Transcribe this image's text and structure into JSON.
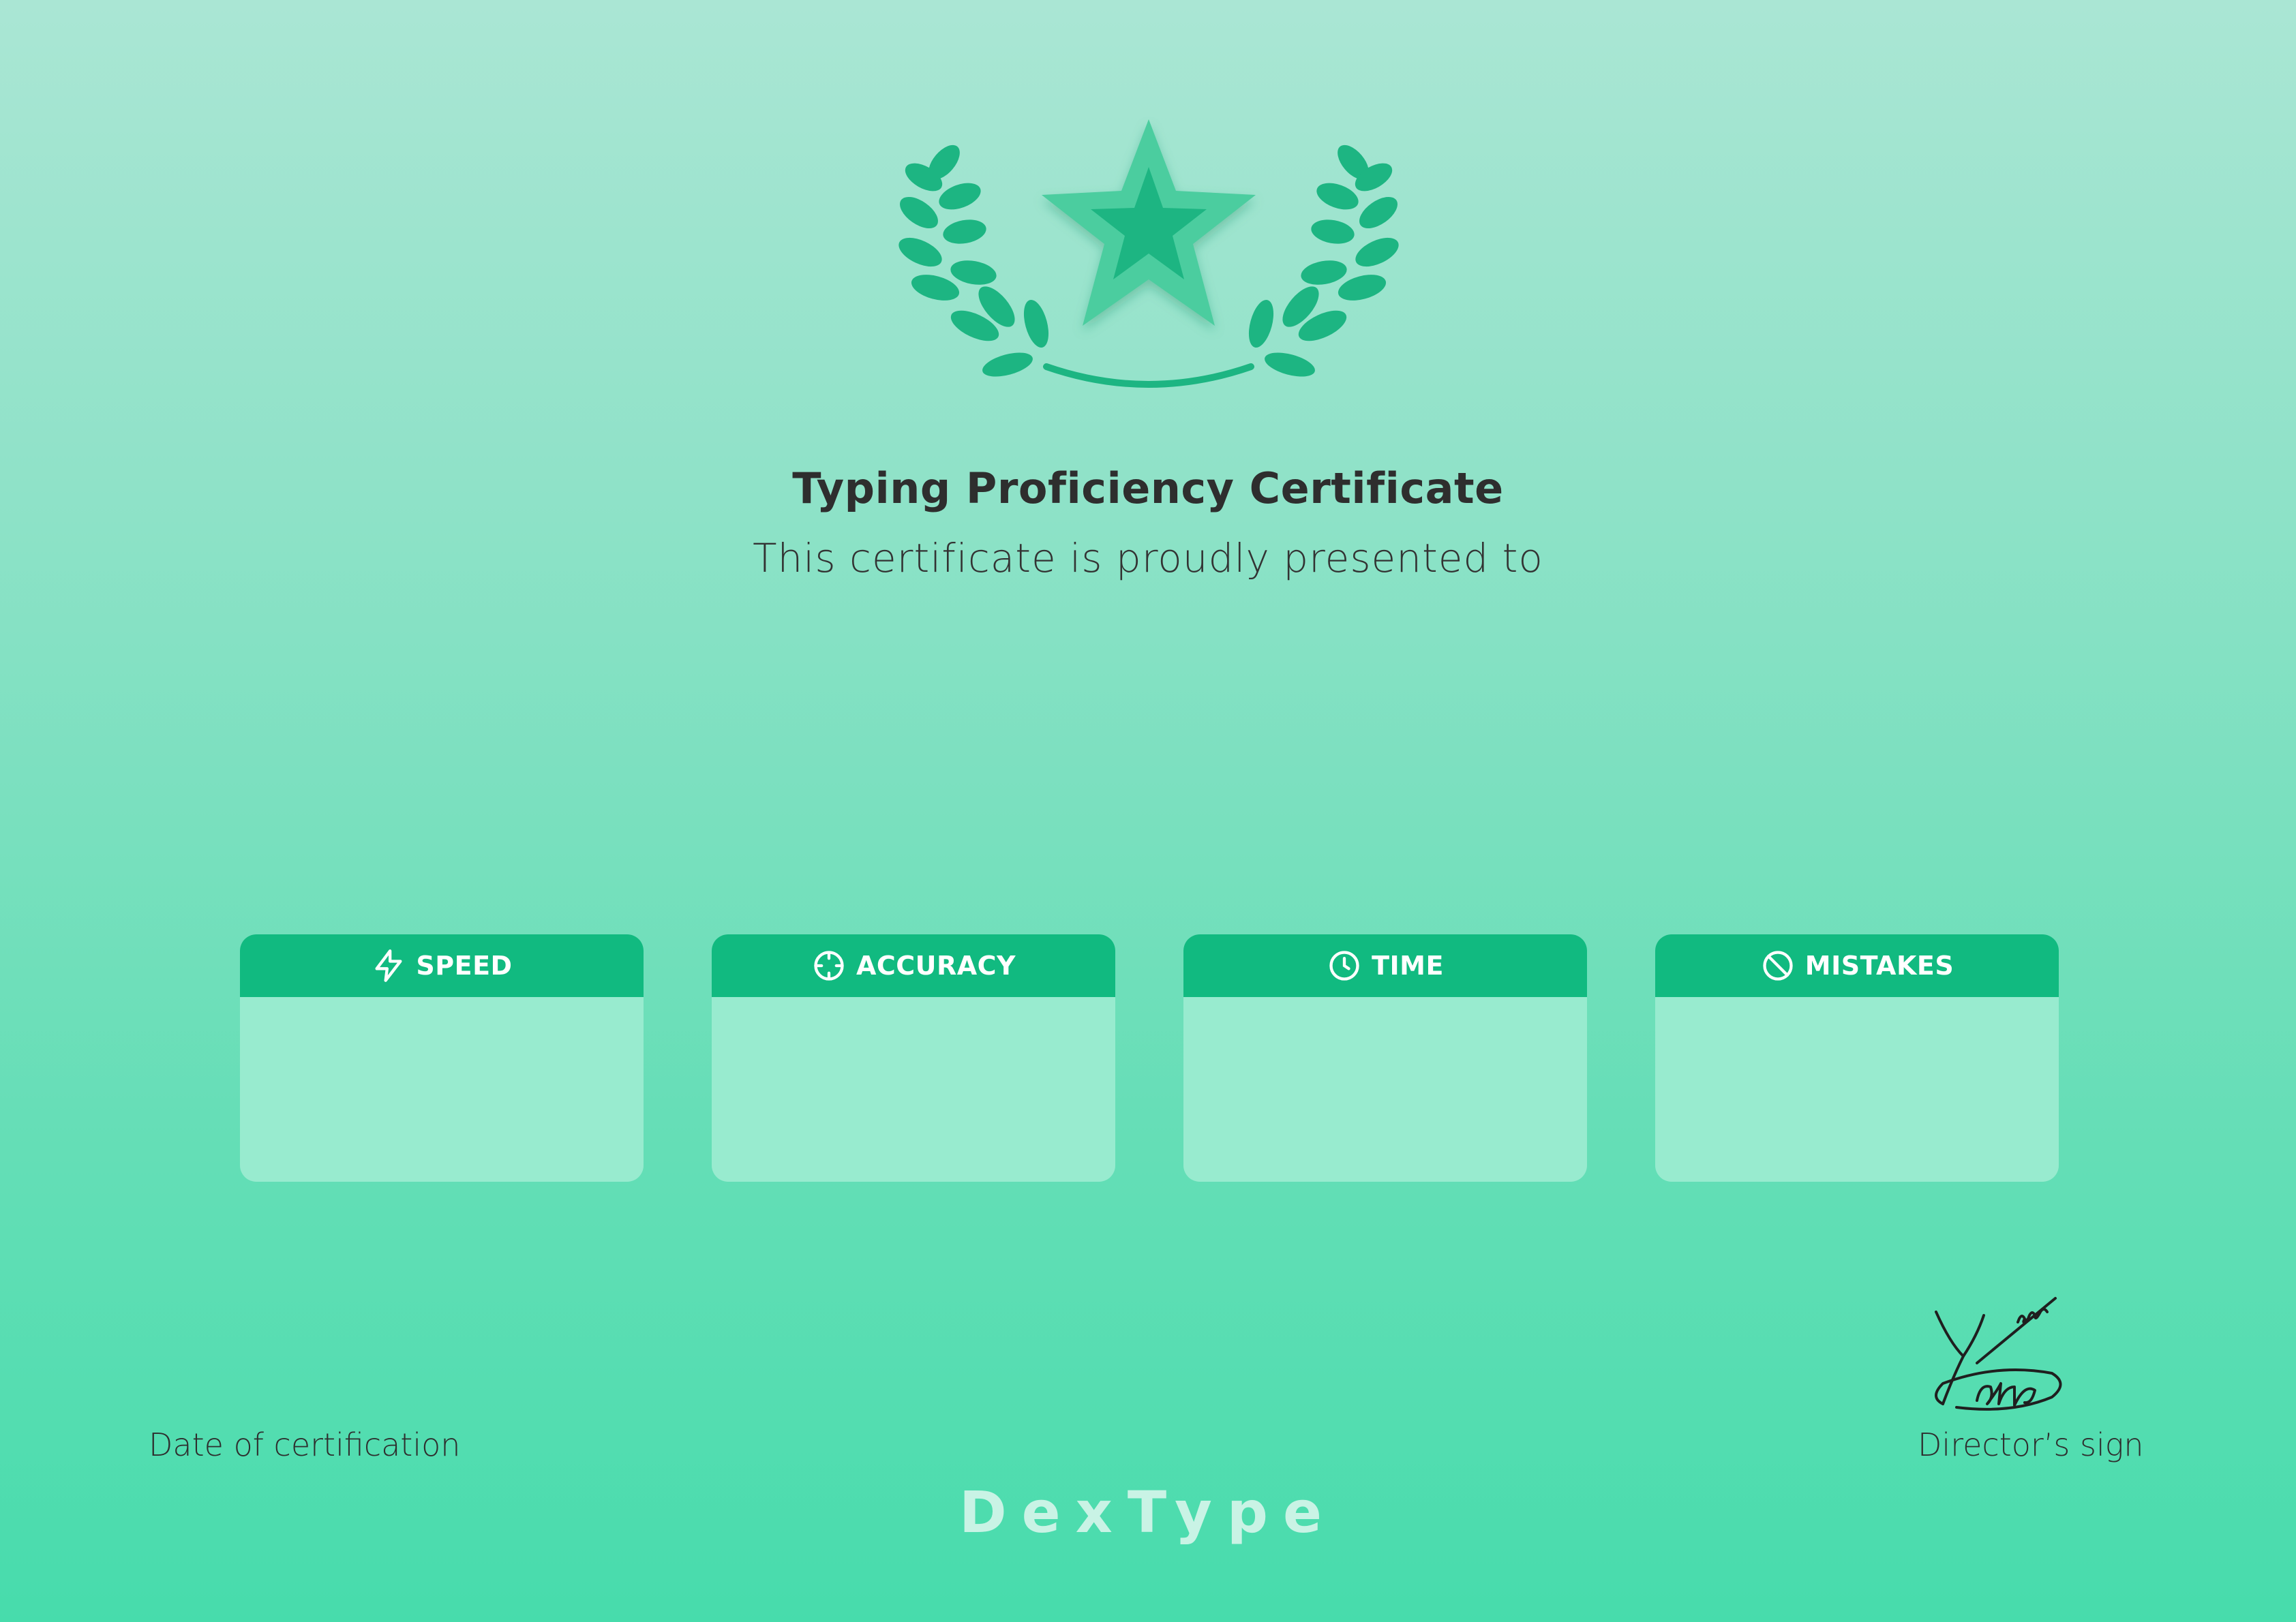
{
  "certificate": {
    "title": "Typing Proficiency Certificate",
    "subtitle": "This certificate is proudly presented to"
  },
  "stats": [
    {
      "label": "SPEED",
      "icon": "lightning-icon"
    },
    {
      "label": "ACCURACY",
      "icon": "crosshair-icon"
    },
    {
      "label": "TIME",
      "icon": "clock-icon"
    },
    {
      "label": "MISTAKES",
      "icon": "prohibited-icon"
    }
  ],
  "footer": {
    "date_label": "Date of certification",
    "sign_label": "Director’s sign",
    "brand": "DexType",
    "signature_text": "Yana"
  },
  "colors": {
    "accent": "#11ba80",
    "card_body": "#98ebcf",
    "emblem_star": "#4bcd9f",
    "emblem_star_inner": "#1db582",
    "laurel": "#1db582",
    "text": "#2e2e2e",
    "brand_text": "#c9f3e5"
  }
}
